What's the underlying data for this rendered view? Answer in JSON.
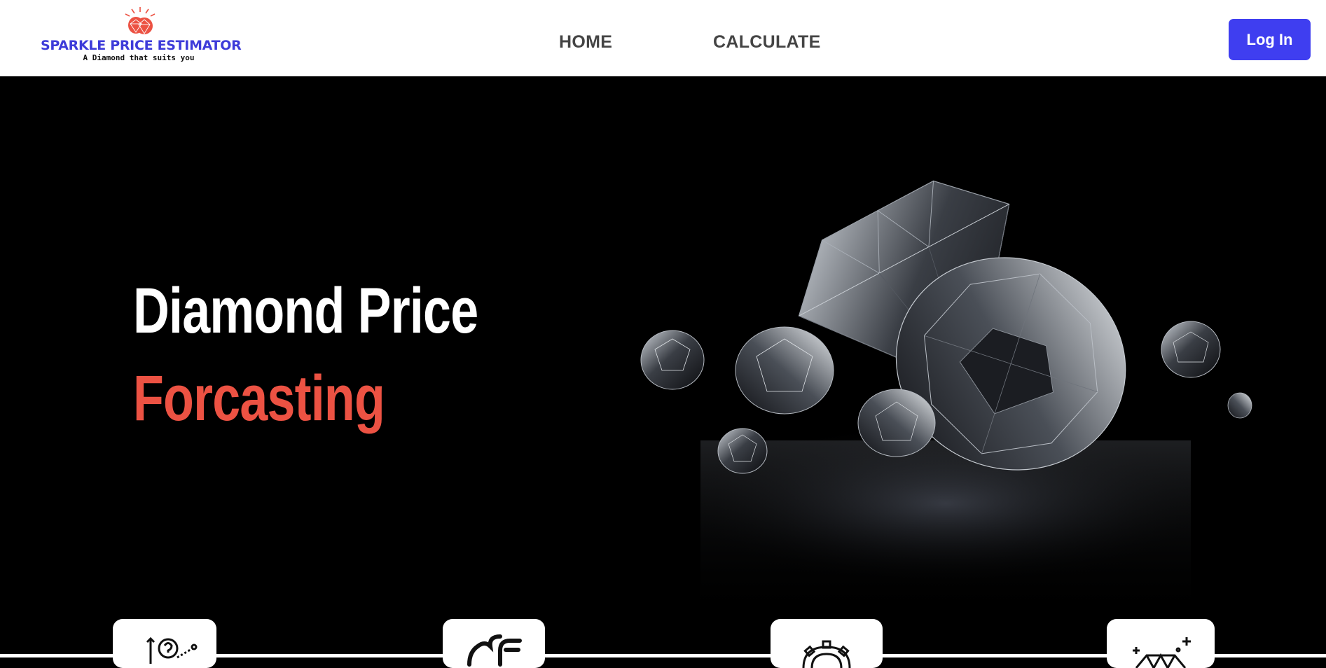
{
  "header": {
    "logo": {
      "title": "SPARKLE PRICE ESTIMATOR",
      "tagline": "A Diamond that suits you",
      "title_color": "#3d3bd9",
      "accent_color": "#ec5243"
    },
    "nav": [
      {
        "label": "HOME"
      },
      {
        "label": "CALCULATE"
      }
    ],
    "login_label": "Log In",
    "login_color": "#3f3ef0"
  },
  "hero": {
    "title_line1": "Diamond Price",
    "title_line2": "Forcasting",
    "title_line2_color": "#ec5243",
    "image": "diamonds-on-black"
  },
  "features": [
    {
      "icon": "question-path-icon"
    },
    {
      "icon": "heart-hand-icon"
    },
    {
      "icon": "gear-icon"
    },
    {
      "icon": "sparkle-diamond-icon"
    }
  ]
}
